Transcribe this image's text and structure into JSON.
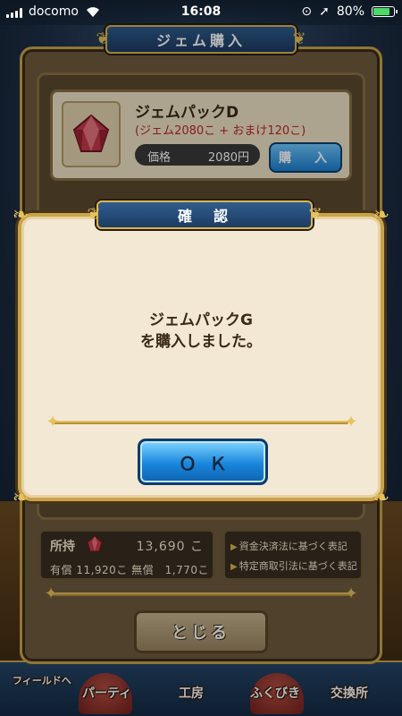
{
  "status_bar": {
    "carrier": "docomo",
    "time": "16:08",
    "battery": "80%",
    "battery_level": 0.8
  },
  "purchase_panel": {
    "title": "ジェム購入",
    "product": {
      "name": "ジェムパックD",
      "detail": "(ジェム2080こ + おまけ120こ)",
      "price_label": "価格",
      "price_value": "2080円",
      "buy_label": "購　入"
    },
    "wallet": {
      "label": "所持",
      "total": "13,690 こ",
      "breakdown": "有償 11,920こ 無償　1,770こ"
    },
    "legal_links": [
      "資金決済法に基づく表記",
      "特定商取引法に基づく表記"
    ],
    "close_label": "とじる"
  },
  "bottom_nav": {
    "items": [
      "フィールドへ",
      "パーティ",
      "工房",
      "ふくびき",
      "交換所"
    ]
  },
  "dialog": {
    "title": "確　認",
    "message_line1": "ジェムパックG",
    "message_line2": "を購入しました。",
    "ok_label": "ＯＫ"
  },
  "colors": {
    "accent_gold": "#c9a24a",
    "button_blue": "#1a86dc",
    "price_red": "#c0282a",
    "dialog_bg": "#f2e8d4"
  }
}
